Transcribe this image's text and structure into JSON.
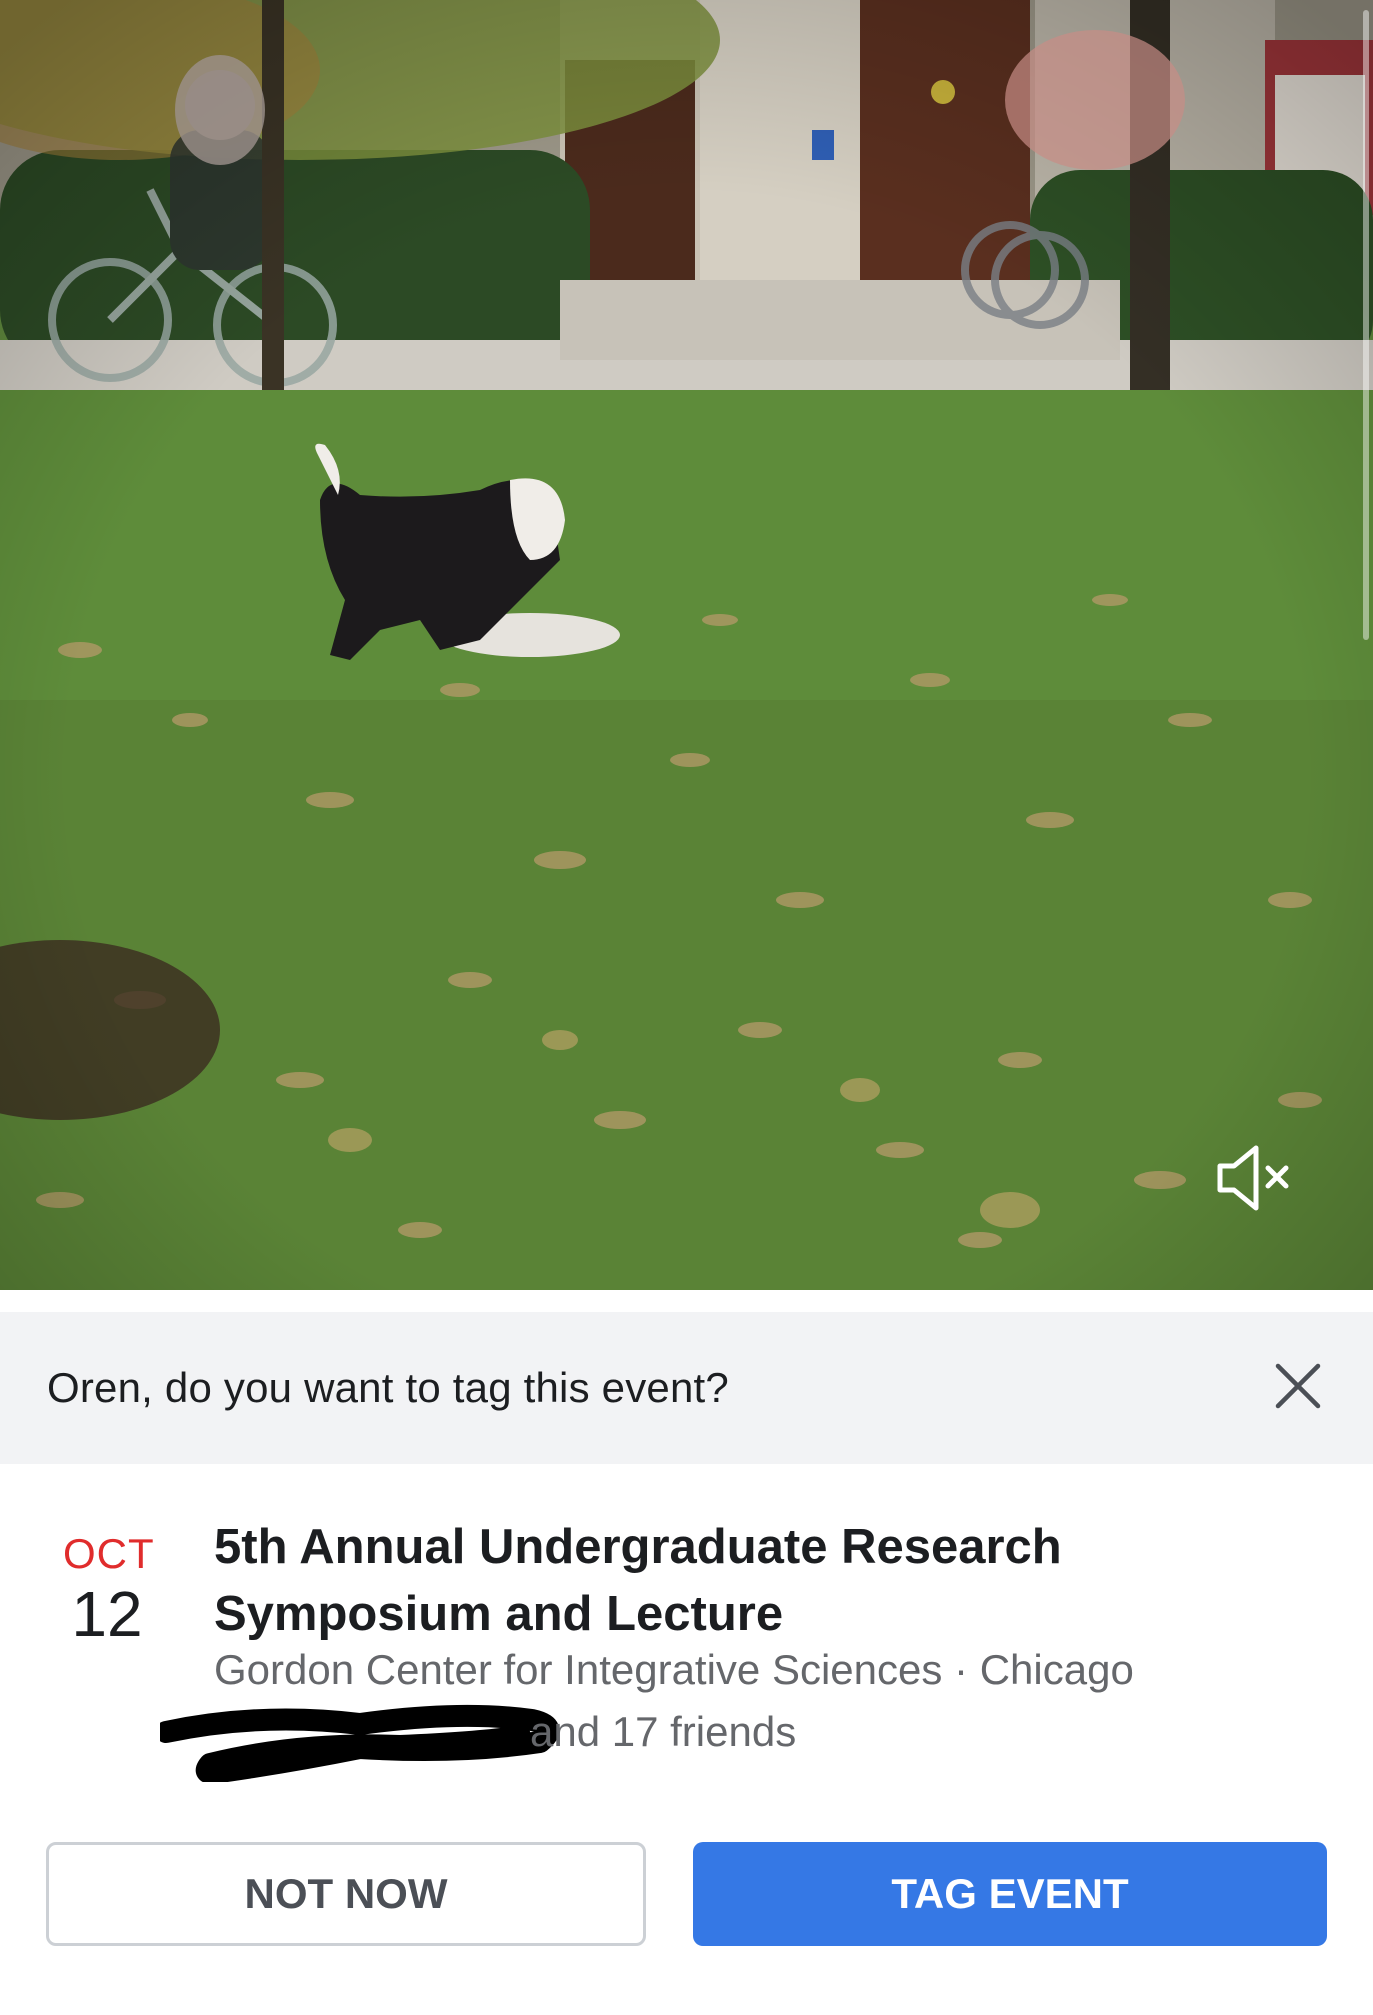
{
  "prompt": {
    "text": "Oren, do you want to tag this event?",
    "close_icon": "close-icon"
  },
  "video": {
    "mute_icon": "speaker-muted-icon"
  },
  "event": {
    "month": "OCT",
    "day": "12",
    "title": "5th Annual Undergraduate Research Symposium and Lecture",
    "location": "Gordon Center for Integrative Sciences · Chicago",
    "friends_text": "and 17 friends"
  },
  "buttons": {
    "not_now": "NOT NOW",
    "tag_event": "TAG EVENT"
  },
  "colors": {
    "accent": "#3578e5",
    "date_month": "#e02c2c",
    "prompt_bg": "#f2f3f5"
  }
}
